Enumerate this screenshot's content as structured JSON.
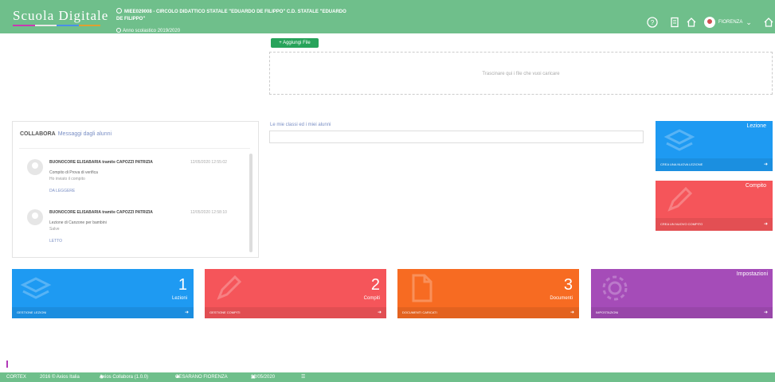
{
  "header": {
    "logo": "Scuola Digitale",
    "logo_colors": [
      "#c83ab0",
      "#e8e8e8",
      "#4b8fe8",
      "#e0a030"
    ],
    "school": "MIEE029008 - CIRCOLO DIDATTICO STATALE \"EDUARDO DE FILIPPO\" C.D. STATALE \"EDUARDO DE FILIPPO\"",
    "school_year": "Anno scolastico 2019/2020",
    "user_name": "FIORENZA",
    "icons": [
      "help-icon",
      "book-icon",
      "home-icon",
      "home-icon"
    ]
  },
  "upload": {
    "add_label": "+ Aggiungi File",
    "dropzone_text": "Trascinare qui i file che vuoi caricare"
  },
  "collabora": {
    "title": "COLLABORA",
    "subtitle": "Messaggi dagli alunni",
    "messages": [
      {
        "from": "BUONOCORE ELISABARIA tramite CAPOZZI PATRIZIA",
        "date": "12/05/2020 12:55:02",
        "subject": "Compito di Prova di verifica",
        "detail": "Ho inviato il compito",
        "status": "DA LEGGERE"
      },
      {
        "from": "BUONOCORE ELISABARIA tramite CAPOZZI PATRIZIA",
        "date": "12/05/2020 12:58:10",
        "subject": "Lezione di Canzone per bambini",
        "detail": "Salve",
        "status": "LETTO"
      }
    ]
  },
  "classes": {
    "label": "Le mie classi ed i miei alunni",
    "placeholder": ""
  },
  "side_tiles": [
    {
      "title": "Lezione",
      "action": "CREA UNA NUOVA LEZIONE",
      "color": "#1e9af2"
    },
    {
      "title": "Compito",
      "action": "CREA UN NUOVO COMPITO",
      "color": "#f5555a"
    }
  ],
  "tiles": [
    {
      "count": "1",
      "label": "Lezioni",
      "action": "GESTIONE LEZIONI",
      "color": "#1e9af2"
    },
    {
      "count": "2",
      "label": "Compiti",
      "action": "GESTIONE COMPITI",
      "color": "#f5555a"
    },
    {
      "count": "3",
      "label": "Documenti",
      "action": "DOCUMENTI CARICATI",
      "color": "#f76b22"
    },
    {
      "title": "Impostazioni",
      "action": "IMPOSTAZIONI",
      "color": "#a54cb8"
    }
  ],
  "footer": {
    "brand": "CORTEX",
    "copyright": "2016 © Axios Italia",
    "app_version": "Axios Collabora (1.0.0)",
    "user": "CESARANO FIORENZA",
    "date": "12/05/2020"
  }
}
